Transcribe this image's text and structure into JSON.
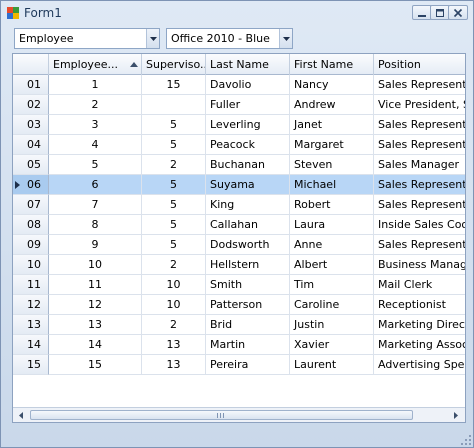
{
  "window": {
    "title": "Form1"
  },
  "toolbar": {
    "table_combo": {
      "value": "Employee"
    },
    "theme_combo": {
      "value": "Office 2010 - Blue"
    }
  },
  "grid": {
    "columns": [
      "Employee...",
      "Superviso...",
      "Last Name",
      "First Name",
      "Position"
    ],
    "sorted_column": "Employee...",
    "selected_row": "06",
    "rows": [
      {
        "hdr": "01",
        "id": "1",
        "sup": "15",
        "last": "Davolio",
        "first": "Nancy",
        "pos": "Sales Representative"
      },
      {
        "hdr": "02",
        "id": "2",
        "sup": "",
        "last": "Fuller",
        "first": "Andrew",
        "pos": "Vice President, Sales"
      },
      {
        "hdr": "03",
        "id": "3",
        "sup": "5",
        "last": "Leverling",
        "first": "Janet",
        "pos": "Sales Representative"
      },
      {
        "hdr": "04",
        "id": "4",
        "sup": "5",
        "last": "Peacock",
        "first": "Margaret",
        "pos": "Sales Representative"
      },
      {
        "hdr": "05",
        "id": "5",
        "sup": "2",
        "last": "Buchanan",
        "first": "Steven",
        "pos": "Sales Manager"
      },
      {
        "hdr": "06",
        "id": "6",
        "sup": "5",
        "last": "Suyama",
        "first": "Michael",
        "pos": "Sales Representative"
      },
      {
        "hdr": "07",
        "id": "7",
        "sup": "5",
        "last": "King",
        "first": "Robert",
        "pos": "Sales Representative"
      },
      {
        "hdr": "08",
        "id": "8",
        "sup": "5",
        "last": "Callahan",
        "first": "Laura",
        "pos": "Inside Sales Coordinator"
      },
      {
        "hdr": "09",
        "id": "9",
        "sup": "5",
        "last": "Dodsworth",
        "first": "Anne",
        "pos": "Sales Representative"
      },
      {
        "hdr": "10",
        "id": "10",
        "sup": "2",
        "last": "Hellstern",
        "first": "Albert",
        "pos": "Business Manager"
      },
      {
        "hdr": "11",
        "id": "11",
        "sup": "10",
        "last": "Smith",
        "first": "Tim",
        "pos": "Mail Clerk"
      },
      {
        "hdr": "12",
        "id": "12",
        "sup": "10",
        "last": "Patterson",
        "first": "Caroline",
        "pos": "Receptionist"
      },
      {
        "hdr": "13",
        "id": "13",
        "sup": "2",
        "last": "Brid",
        "first": "Justin",
        "pos": "Marketing Director"
      },
      {
        "hdr": "14",
        "id": "14",
        "sup": "13",
        "last": "Martin",
        "first": "Xavier",
        "pos": "Marketing Associate"
      },
      {
        "hdr": "15",
        "id": "15",
        "sup": "13",
        "last": "Pereira",
        "first": "Laurent",
        "pos": "Advertising Specialist"
      }
    ]
  },
  "icons": {
    "app": "form-app-icon",
    "minimize": "minimize-icon",
    "maximize": "maximize-icon",
    "close": "close-icon",
    "dropdown": "chevron-down-icon",
    "sort": "sort-ascending-icon",
    "current_row": "row-pointer-icon",
    "scroll_left": "arrow-left-icon",
    "scroll_right": "arrow-right-icon"
  },
  "colors": {
    "selection": "#b8d6f6",
    "header": "#e5ecf5",
    "border": "#8da2c0",
    "chrome": "#cfdbeb"
  }
}
